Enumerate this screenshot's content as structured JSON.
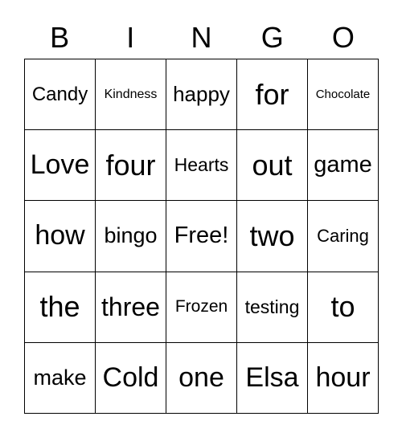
{
  "header": [
    "B",
    "I",
    "N",
    "G",
    "O"
  ],
  "cells": [
    "Candy",
    "Kindness",
    "happy",
    "for",
    "Chocolate",
    "Love",
    "four",
    "Hearts",
    "out",
    "game",
    "how",
    "bingo",
    "Free!",
    "two",
    "Caring",
    "the",
    "three",
    "Frozen",
    "testing",
    "to",
    "make",
    "Cold",
    "one",
    "Elsa",
    "hour"
  ]
}
